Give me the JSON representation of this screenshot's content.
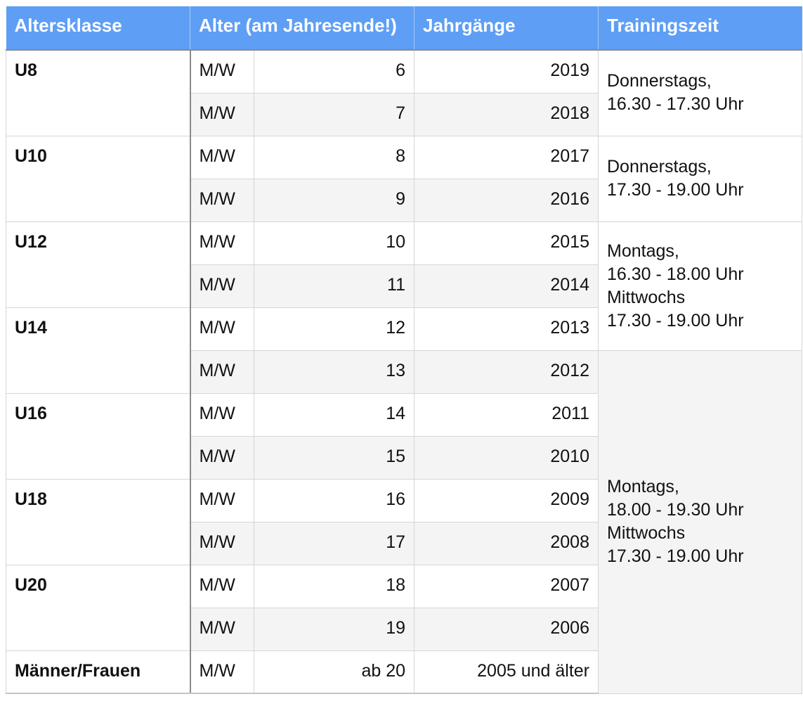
{
  "headers": [
    "Altersklasse",
    "Alter (am Jahresende!)",
    "Jahrgänge",
    "Trainingszeit"
  ],
  "rows": [
    {
      "cls": "U8",
      "sex": "M/W",
      "age": "6",
      "year": "2019"
    },
    {
      "cls": "",
      "sex": "M/W",
      "age": "7",
      "year": "2018"
    },
    {
      "cls": "U10",
      "sex": "M/W",
      "age": "8",
      "year": "2017"
    },
    {
      "cls": "",
      "sex": "M/W",
      "age": "9",
      "year": "2016"
    },
    {
      "cls": "U12",
      "sex": "M/W",
      "age": "10",
      "year": "2015"
    },
    {
      "cls": "",
      "sex": "M/W",
      "age": "11",
      "year": "2014"
    },
    {
      "cls": "U14",
      "sex": "M/W",
      "age": "12",
      "year": "2013"
    },
    {
      "cls": "",
      "sex": "M/W",
      "age": "13",
      "year": "2012"
    },
    {
      "cls": "U16",
      "sex": "M/W",
      "age": "14",
      "year": "2011"
    },
    {
      "cls": "",
      "sex": "M/W",
      "age": "15",
      "year": "2010"
    },
    {
      "cls": "U18",
      "sex": "M/W",
      "age": "16",
      "year": "2009"
    },
    {
      "cls": "",
      "sex": "M/W",
      "age": "17",
      "year": "2008"
    },
    {
      "cls": "U20",
      "sex": "M/W",
      "age": "18",
      "year": "2007"
    },
    {
      "cls": "",
      "sex": "M/W",
      "age": "19",
      "year": "2006"
    },
    {
      "cls": "Männer/Frauen",
      "sex": "M/W",
      "age": "ab 20",
      "year": "2005 und älter"
    }
  ],
  "training": [
    [
      "Donnerstags,",
      "16.30 - 17.30 Uhr"
    ],
    [
      "Donnerstags,",
      "17.30 - 19.00 Uhr"
    ],
    [
      "Montags,",
      "16.30 - 18.00 Uhr",
      "Mittwochs",
      "17.30 - 19.00 Uhr"
    ],
    [
      "Montags,",
      "18.00 - 19.30 Uhr",
      "Mittwochs",
      "17.30 - 19.00 Uhr"
    ]
  ]
}
